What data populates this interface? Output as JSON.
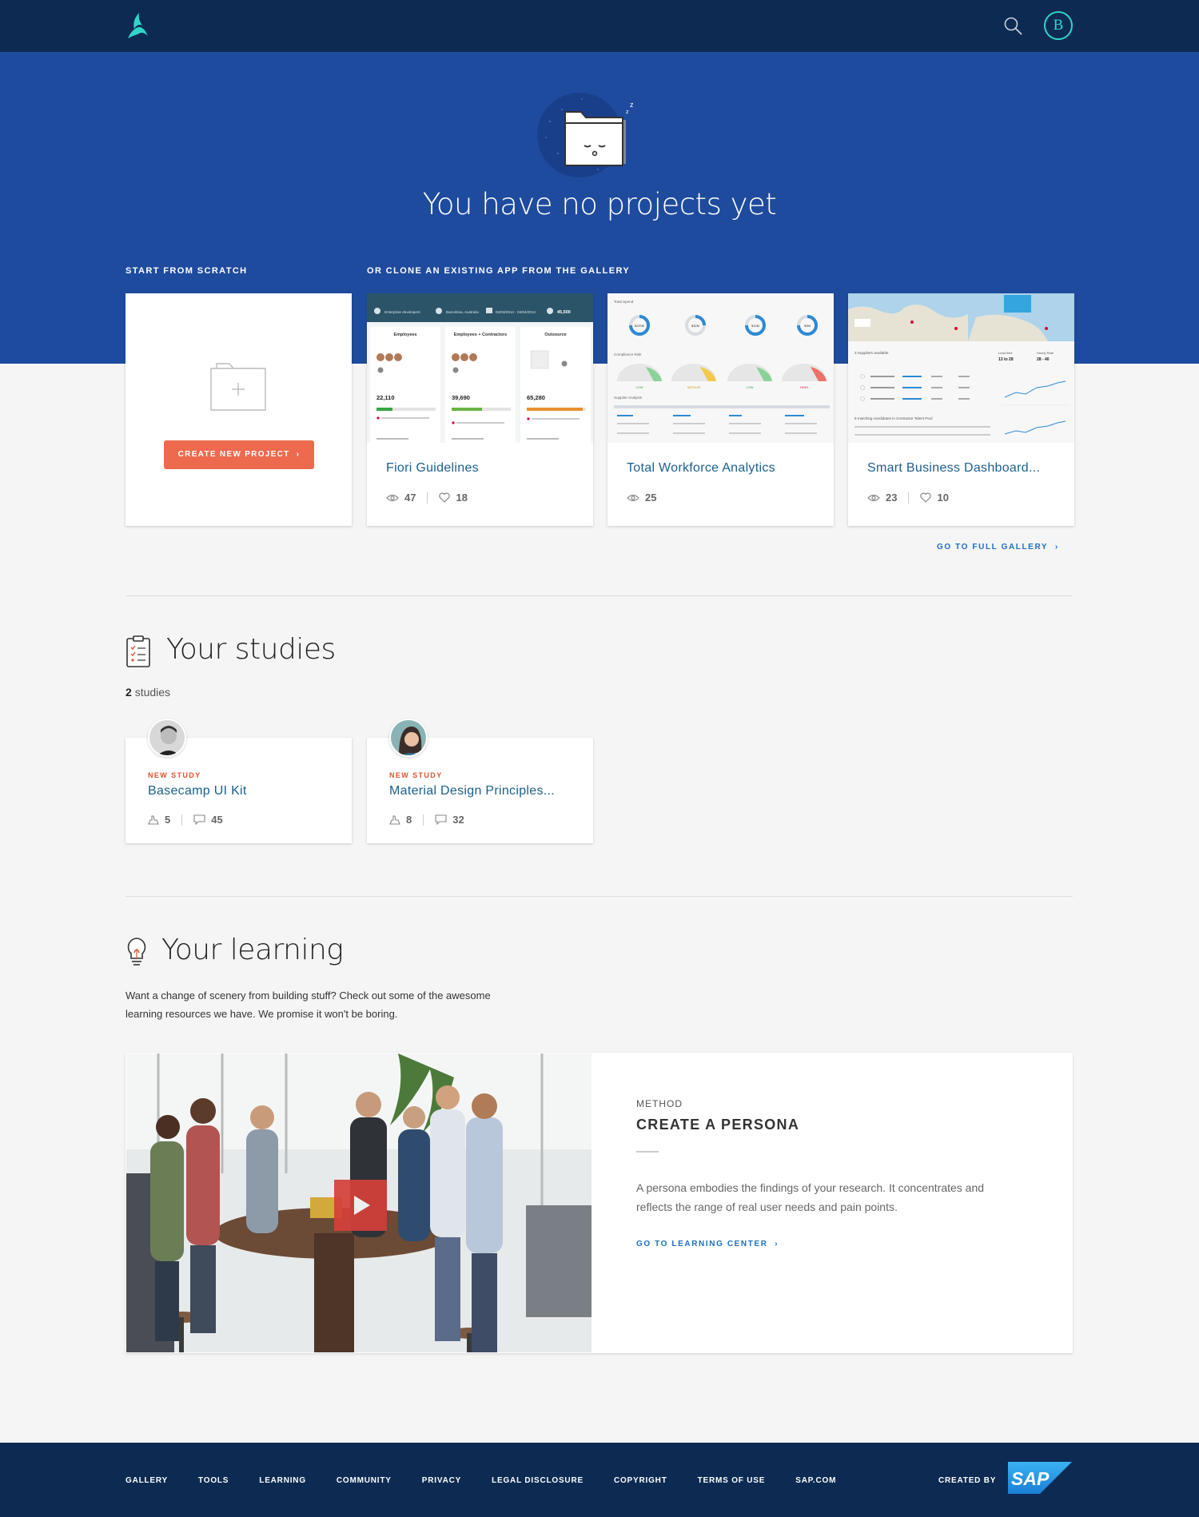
{
  "header": {
    "logo_icon": "buildapp-logo-icon",
    "search_icon": "search-icon",
    "avatar_initial": "B",
    "accent": "#30d5c8"
  },
  "hero": {
    "title": "You have no projects yet",
    "scratch_label": "START FROM SCRATCH",
    "gallery_label": "OR CLONE AN EXISTING APP FROM THE GALLERY",
    "create_button": "CREATE NEW PROJECT",
    "background": "#1f4b9e"
  },
  "gallery": {
    "items": [
      {
        "title": "Fiori Guidelines",
        "views": "47",
        "likes": "18"
      },
      {
        "title": "Total Workforce Analytics",
        "views": "25"
      },
      {
        "title": "Smart Business Dashboard...",
        "views": "23",
        "likes": "10"
      }
    ],
    "full_link": "GO TO FULL GALLERY",
    "thumb1": {
      "top": [
        "Enterprise developers",
        "Barcelona, Australia",
        "04/03/2014 - 04/04/2014",
        "45,500"
      ],
      "cols": [
        "Employees",
        "Employees + Contractors",
        "Outsource"
      ],
      "values": [
        "22,110",
        "39,690",
        "65,280"
      ]
    },
    "thumb2": {
      "labels": [
        "Total Spend",
        "Compliance Risk",
        "Supplier Analysis"
      ],
      "rings": [
        "$220M",
        "$32M",
        "$10M",
        "$3M"
      ],
      "risk": [
        "LOW",
        "MEDIUM",
        "LOW",
        "HIGH"
      ]
    },
    "thumb3": {
      "labels": [
        "3 Suppliers available",
        "Lead time",
        "Hourly Rate",
        "8 matching candidates in Contractor Talent Pool"
      ],
      "values": [
        "13 to 28",
        "28 - 40"
      ]
    }
  },
  "studies": {
    "title": "Your studies",
    "count": "2",
    "count_label": "studies",
    "items": [
      {
        "tag": "NEW STUDY",
        "title": "Basecamp UI Kit",
        "participants": "5",
        "comments": "45"
      },
      {
        "tag": "NEW STUDY",
        "title": "Material Design Principles...",
        "participants": "8",
        "comments": "32"
      }
    ]
  },
  "learning": {
    "title": "Your learning",
    "description": "Want a change of scenery from building stuff? Check out some of the awesome learning resources we have. We promise it won't be boring.",
    "kicker": "METHOD",
    "card_title": "CREATE A PERSONA",
    "card_desc": "A persona embodies the findings of your research. It concentrates and reflects the range of real user needs and pain points.",
    "link": "GO TO LEARNING CENTER",
    "play_icon": "play-icon"
  },
  "footer": {
    "links": [
      "GALLERY",
      "TOOLS",
      "LEARNING",
      "COMMUNITY",
      "PRIVACY",
      "LEGAL DISCLOSURE",
      "COPYRIGHT",
      "TERMS OF USE",
      "SAP.COM"
    ],
    "created_by": "CREATED BY",
    "brand": "SAP"
  }
}
